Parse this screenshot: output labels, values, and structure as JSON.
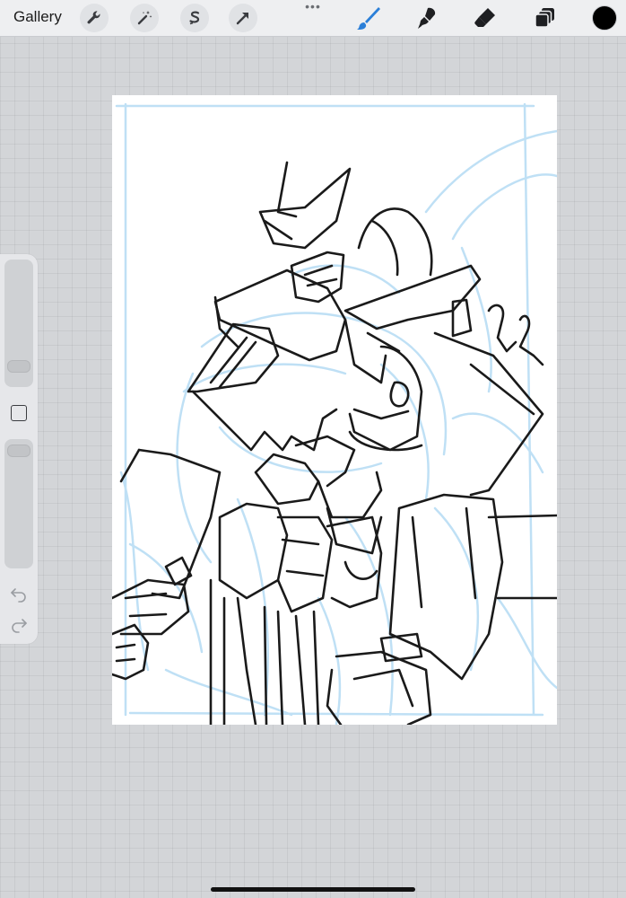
{
  "toolbar": {
    "gallery_label": "Gallery",
    "left_tools": [
      "wrench-icon",
      "magic-wand-icon",
      "selection-s-icon",
      "transform-arrow-icon"
    ],
    "right_tools": [
      "brush-icon",
      "smudge-icon",
      "eraser-icon",
      "layers-icon"
    ],
    "active_tool": "brush",
    "accent_color": "#2b7fd8",
    "current_color": "#000000"
  },
  "sidebar": {
    "brush_size_slider": "brush-size",
    "opacity_slider": "opacity",
    "modify_button": "square-icon",
    "undo": "undo-icon",
    "redo": "redo-icon"
  },
  "canvas": {
    "background": "#ffffff",
    "sketch_color": "#bfe0f5",
    "lineart_color": "#111111"
  }
}
